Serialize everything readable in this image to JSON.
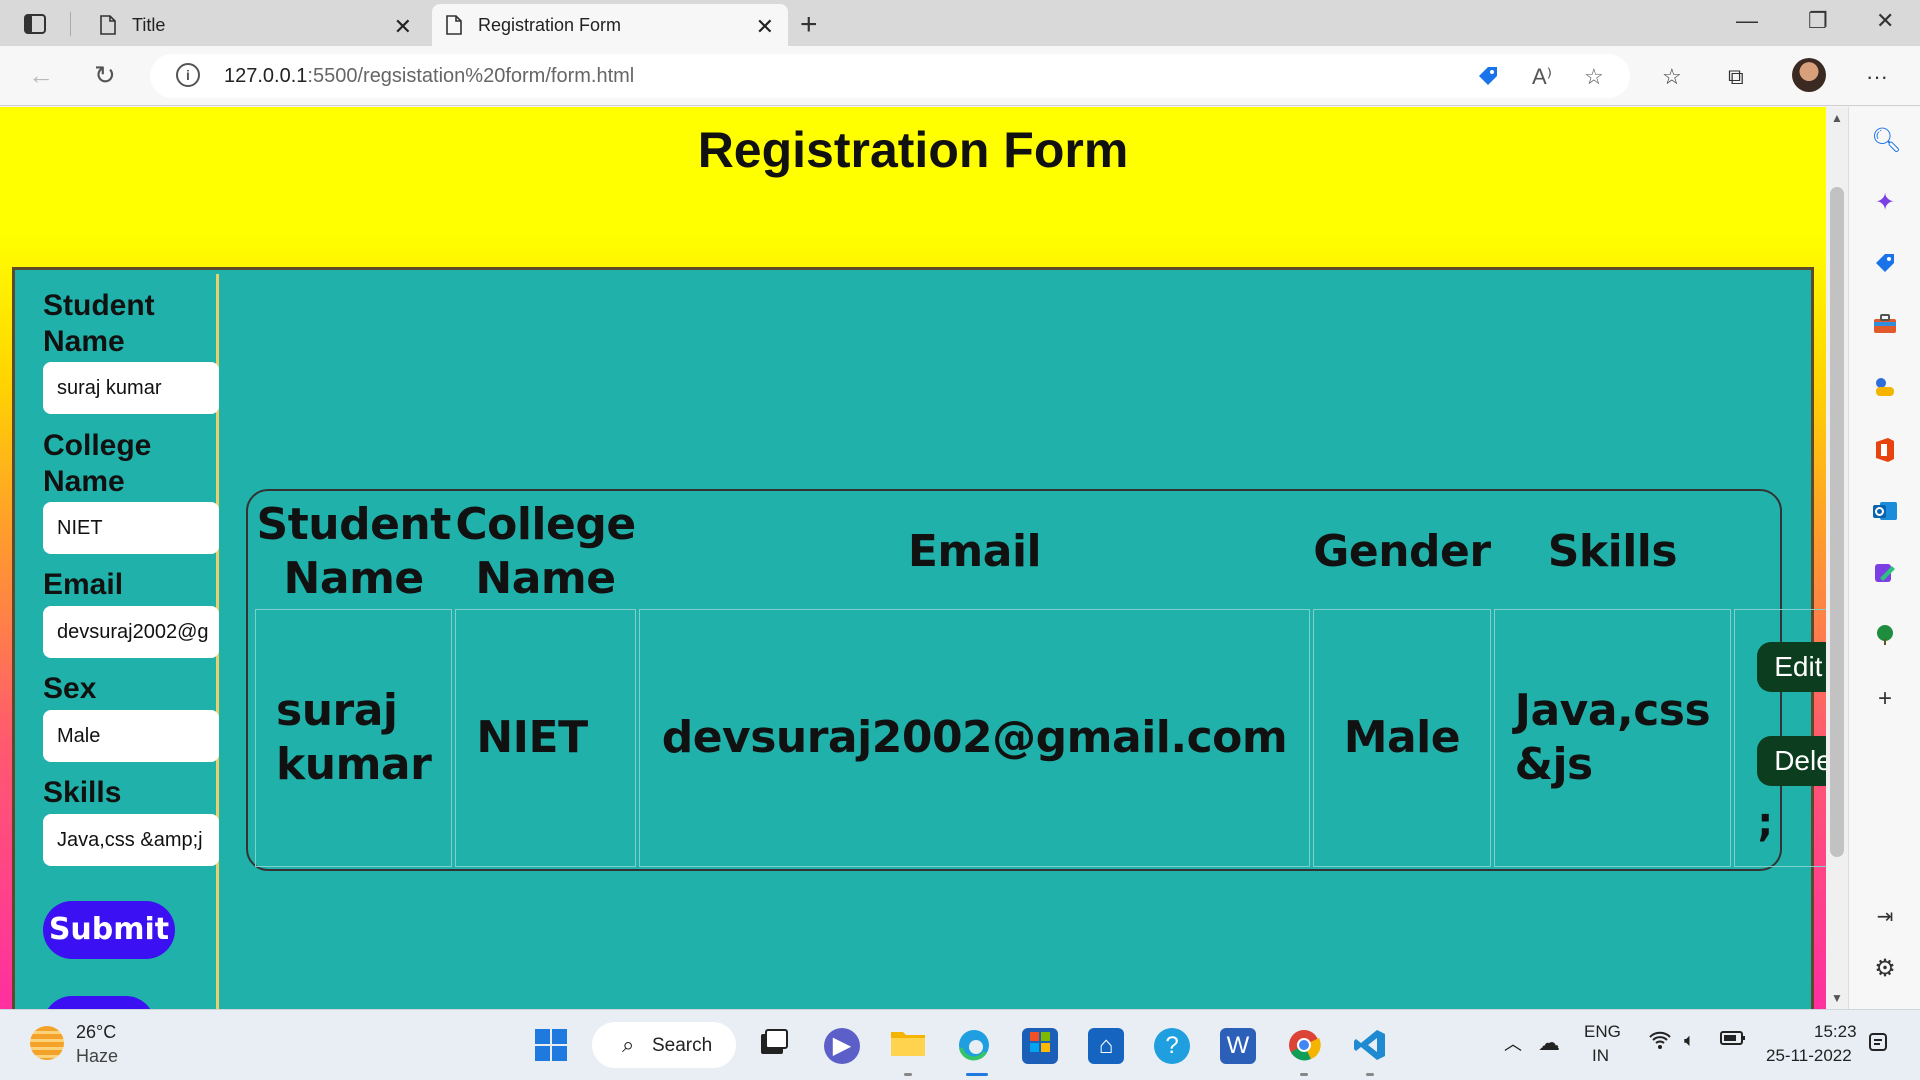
{
  "browser": {
    "tabs": [
      {
        "title": "Title"
      },
      {
        "title": "Registration Form"
      }
    ],
    "url": {
      "host": "127.0.0.1",
      "path": ":5500/regsistation%20form/form.html"
    }
  },
  "page": {
    "title": "Registration Form",
    "form": {
      "fields": [
        {
          "label": "Student Name",
          "value": "suraj kumar"
        },
        {
          "label": "College Name",
          "value": "NIET"
        },
        {
          "label": "Email",
          "value": "devsuraj2002@g"
        },
        {
          "label": "Sex",
          "value": "Male"
        },
        {
          "label": "Skills",
          "value": "Java,css &amp;j"
        }
      ],
      "submit_label": "Submit"
    },
    "table": {
      "headers": [
        "Student Name",
        "College Name",
        "Email",
        "Gender",
        "Skills",
        ""
      ],
      "rows": [
        {
          "student_name": "suraj kumar",
          "college_name": "NIET",
          "email": "devsuraj2002@gmail.com",
          "gender": "Male",
          "skills": "Java,css &js",
          "edit_label": "Edit",
          "delete_label": "Delete",
          "trailing": ";"
        }
      ]
    }
  },
  "taskbar": {
    "weather": {
      "temp": "26°C",
      "condition": "Haze"
    },
    "search_label": "Search",
    "lang": {
      "line1": "ENG",
      "line2": "IN"
    },
    "clock": {
      "time": "15:23",
      "date": "25-11-2022"
    }
  },
  "colors": {
    "form_bg": "#20b2aa",
    "submit_bg": "#3b10f2",
    "action_btn_bg": "#0b3d1e",
    "page_top": "#ffff00",
    "page_bottom": "#ff2fa0"
  }
}
